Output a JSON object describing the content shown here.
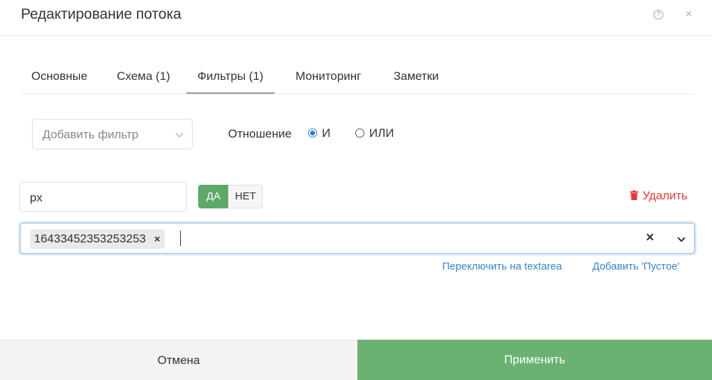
{
  "dialog": {
    "title": "Редактирование потока",
    "help_icon": "question-circle-icon",
    "close_icon": "close-icon",
    "help_glyph": "?",
    "close_glyph": "×"
  },
  "tabs": [
    {
      "label": "Основные",
      "active": false
    },
    {
      "label": "Схема (1)",
      "active": false
    },
    {
      "label": "Фильтры (1)",
      "active": true
    },
    {
      "label": "Мониторинг",
      "active": false
    },
    {
      "label": "Заметки",
      "active": false
    }
  ],
  "filter_controls": {
    "add_filter_placeholder": "Добавить фильтр",
    "relation_label": "Отношение",
    "relation_options": [
      {
        "label": "И",
        "checked": true
      },
      {
        "label": "ИЛИ",
        "checked": false
      }
    ]
  },
  "filter": {
    "field_value": "px",
    "toggle_yes": "ДА",
    "toggle_no": "НЕТ",
    "toggle_selected": "ДА",
    "delete_label": "Удалить",
    "tags": [
      {
        "label": "16433452353253253",
        "remove_glyph": "×"
      }
    ],
    "clear_glyph": "×",
    "links": {
      "switch_textarea": "Переключить на textarea",
      "add_empty": "Добавить 'Пустое'"
    }
  },
  "footer": {
    "cancel_label": "Отмена",
    "apply_label": "Применить"
  },
  "colors": {
    "accent_green": "#6bb272",
    "delete_red": "#e03c3c",
    "link_blue": "#3a84c4",
    "radio_blue": "#2a7ae2"
  }
}
